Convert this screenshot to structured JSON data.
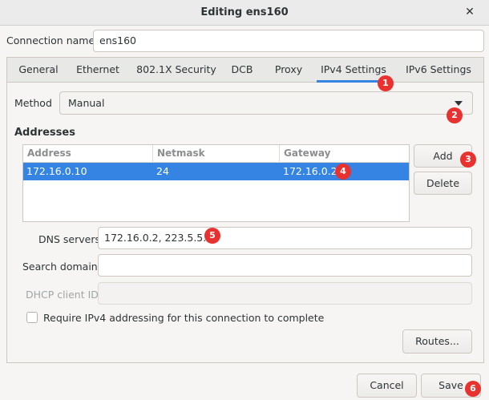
{
  "window": {
    "title": "Editing ens160"
  },
  "connection": {
    "label": "Connection name",
    "value": "ens160"
  },
  "tabs": [
    {
      "label": "General"
    },
    {
      "label": "Ethernet"
    },
    {
      "label": "802.1X Security"
    },
    {
      "label": "DCB"
    },
    {
      "label": "Proxy"
    },
    {
      "label": "IPv4 Settings",
      "active": true
    },
    {
      "label": "IPv6 Settings"
    }
  ],
  "method": {
    "label": "Method",
    "value": "Manual"
  },
  "addresses": {
    "title": "Addresses",
    "columns": [
      "Address",
      "Netmask",
      "Gateway"
    ],
    "rows": [
      {
        "address": "172.16.0.10",
        "netmask": "24",
        "gateway": "172.16.0.2"
      }
    ],
    "add_label": "Add",
    "delete_label": "Delete"
  },
  "dns": {
    "label": "DNS servers",
    "value": "172.16.0.2, 223.5.5.5"
  },
  "search_domains": {
    "label": "Search domains",
    "value": ""
  },
  "dhcp_client_id": {
    "label": "DHCP client ID",
    "value": ""
  },
  "require_ipv4": {
    "label": "Require IPv4 addressing for this connection to complete",
    "checked": false
  },
  "routes_label": "Routes...",
  "footer": {
    "cancel_label": "Cancel",
    "save_label": "Save"
  },
  "badges": [
    "1",
    "2",
    "3",
    "4",
    "5",
    "6"
  ],
  "colors": {
    "accent": "#3584e4",
    "badge": "#e8322f"
  }
}
